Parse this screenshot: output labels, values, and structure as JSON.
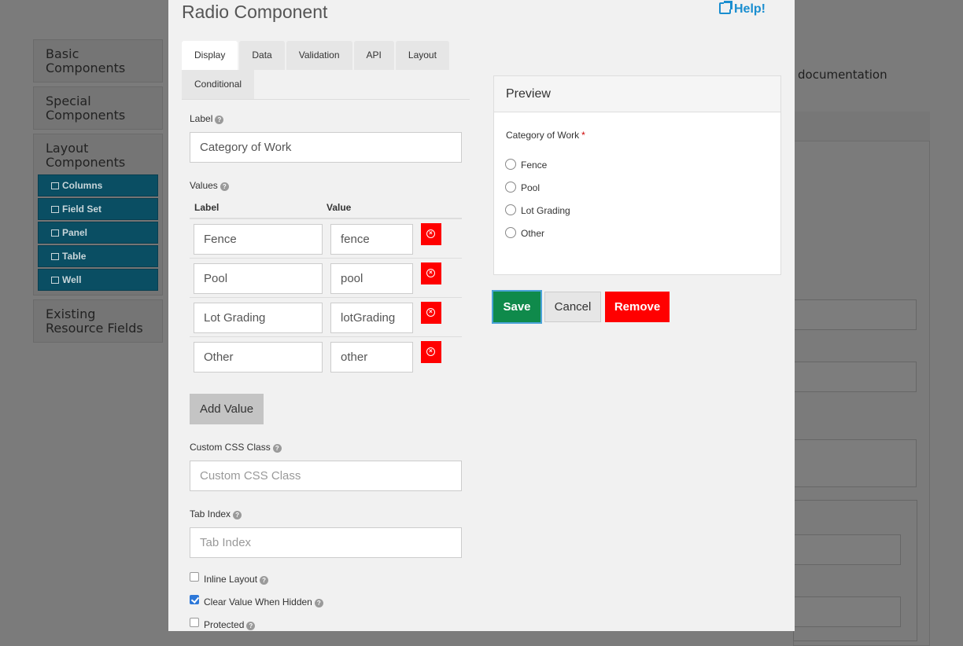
{
  "sidebar": {
    "groups": [
      {
        "label_line1": "Basic",
        "label_line2": "Components"
      },
      {
        "label_line1": "Special",
        "label_line2": "Components"
      },
      {
        "label_line1": "Layout",
        "label_line2": "Components"
      },
      {
        "label_line1": "Existing",
        "label_line2": "Resource Fields"
      }
    ],
    "layout_items": [
      {
        "label": "Columns",
        "icon": "columns-icon"
      },
      {
        "label": "Field Set",
        "icon": "th-large-icon"
      },
      {
        "label": "Panel",
        "icon": "list-alt-icon"
      },
      {
        "label": "Table",
        "icon": "table-icon"
      },
      {
        "label": "Well",
        "icon": "square-icon"
      }
    ]
  },
  "background": {
    "documentation_text": "documentation"
  },
  "modal": {
    "title": "Radio Component",
    "help_label": "Help!",
    "tabs": [
      {
        "label": "Display",
        "active": true
      },
      {
        "label": "Data",
        "active": false
      },
      {
        "label": "Validation",
        "active": false
      },
      {
        "label": "API",
        "active": false
      },
      {
        "label": "Layout",
        "active": false
      },
      {
        "label": "Conditional",
        "active": false
      }
    ],
    "label_field": {
      "label": "Label",
      "value": "Category of Work"
    },
    "values": {
      "label": "Values",
      "col_label": "Label",
      "col_value": "Value",
      "rows": [
        {
          "label": "Fence",
          "value": "fence"
        },
        {
          "label": "Pool",
          "value": "pool"
        },
        {
          "label": "Lot Grading",
          "value": "lotGrading"
        },
        {
          "label": "Other",
          "value": "other"
        }
      ],
      "add_button": "Add Value"
    },
    "custom_css": {
      "label": "Custom CSS Class",
      "placeholder": "Custom CSS Class",
      "value": ""
    },
    "tab_index": {
      "label": "Tab Index",
      "placeholder": "Tab Index",
      "value": ""
    },
    "checkboxes": [
      {
        "label": "Inline Layout",
        "checked": false
      },
      {
        "label": "Clear Value When Hidden",
        "checked": true
      },
      {
        "label": "Protected",
        "checked": false
      }
    ],
    "preview": {
      "title": "Preview",
      "field_label": "Category of Work",
      "required_mark": "*",
      "options": [
        "Fence",
        "Pool",
        "Lot Grading",
        "Other"
      ]
    },
    "buttons": {
      "save": "Save",
      "cancel": "Cancel",
      "remove": "Remove"
    }
  },
  "colors": {
    "save": "#0f8a4b",
    "remove": "#ff0000",
    "help_link": "#1a8ed0",
    "layout_item": "#0a4e63"
  }
}
